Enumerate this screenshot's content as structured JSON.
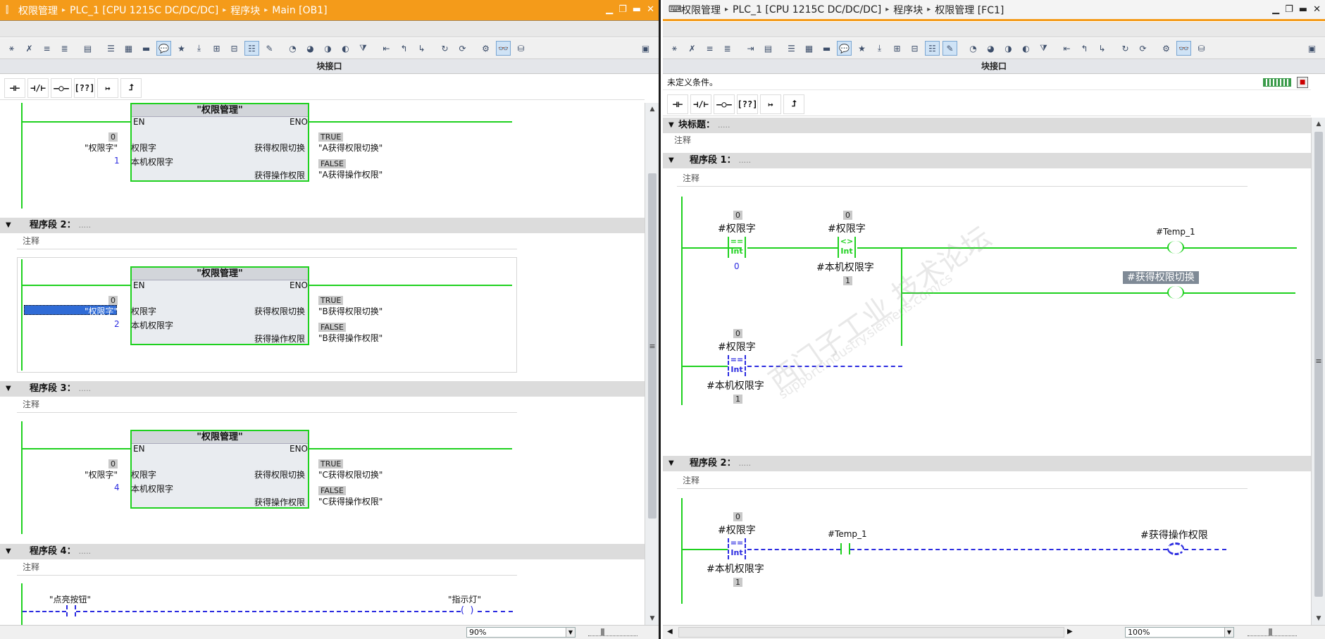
{
  "left": {
    "breadcrumb": [
      "权限管理",
      "PLC_1 [CPU 1215C DC/DC/DC]",
      "程序块",
      "Main [OB1]"
    ],
    "iface_label": "块接口",
    "zoom": "90%",
    "ladder_buttons": [
      "⊣⊢",
      "⊣/⊢",
      "–○–",
      "[??]",
      "↦",
      "⮥"
    ],
    "networks": [
      {
        "label": "程序段 2：",
        "comment": "注释"
      },
      {
        "label": "程序段 3：",
        "comment": "注释"
      },
      {
        "label": "程序段 4：",
        "comment": "注释"
      }
    ],
    "fb": {
      "name": "\"权限管理\"",
      "en": "EN",
      "eno": "ENO",
      "in1": "权限字",
      "in2": "本机权限字",
      "out1": "获得权限切换",
      "out2": "获得操作权限"
    },
    "blocks": [
      {
        "in1_val": "\"权限字\"",
        "in1_box": "0",
        "in2_val": "1",
        "out1_box": "TRUE",
        "out1_val": "\"A获得权限切换\"",
        "out2_box": "FALSE",
        "out2_val": "\"A获得操作权限\""
      },
      {
        "in1_val": "\"权限字\"",
        "in1_box": "0",
        "in2_val": "2",
        "out1_box": "TRUE",
        "out1_val": "\"B获得权限切换\"",
        "out2_box": "FALSE",
        "out2_val": "\"B获得操作权限\""
      },
      {
        "in1_val": "\"权限字\"",
        "in1_box": "0",
        "in2_val": "4",
        "out1_box": "TRUE",
        "out1_val": "\"C获得权限切换\"",
        "out2_box": "FALSE",
        "out2_val": "\"C获得操作权限\""
      }
    ],
    "net4": {
      "contact": "\"点亮按钮\"",
      "coil": "\"指示灯\""
    }
  },
  "right": {
    "breadcrumb": [
      "权限管理",
      "PLC_1 [CPU 1215C DC/DC/DC]",
      "程序块",
      "权限管理 [FC1]"
    ],
    "iface_label": "块接口",
    "zoom": "100%",
    "condition": "未定义条件。",
    "ladder_buttons": [
      "⊣⊢",
      "⊣/⊢",
      "–○–",
      "[??]",
      "↦",
      "⮥"
    ],
    "block_title": "块标题：",
    "block_title_dots": ".....",
    "block_comment": "注释",
    "networks": [
      {
        "label": "程序段 1：",
        "comment": "注释"
      },
      {
        "label": "程序段 2：",
        "comment": "注释"
      }
    ],
    "n1": {
      "c1_top": "#权限字",
      "c1_box": "0",
      "c1_op": "==",
      "c1_type": "Int",
      "c1_bot": "0",
      "c2_top": "#权限字",
      "c2_box": "0",
      "c2_op": "<>",
      "c2_type": "Int",
      "c2_bot": "#本机权限字",
      "c2_botbox": "1",
      "c3_top": "#权限字",
      "c3_box": "0",
      "c3_op": "==",
      "c3_type": "Int",
      "c3_bot": "#本机权限字",
      "c3_botbox": "1",
      "coil1": "#Temp_1",
      "coil2": "#获得权限切换"
    },
    "n2": {
      "c1_top": "#权限字",
      "c1_box": "0",
      "c1_op": "==",
      "c1_type": "Int",
      "c1_bot": "#本机权限字",
      "c1_botbox": "1",
      "contact": "#Temp_1",
      "coil": "#获得操作权限"
    },
    "watermark": "西门子工业 技术论坛",
    "watermark_url": "support.industry.siemens.com/cs"
  },
  "colors": {
    "accent": "#f49b1a",
    "energized": "#1fd11f",
    "unpowered": "#2b2be0",
    "selection": "#2f6bd6"
  }
}
